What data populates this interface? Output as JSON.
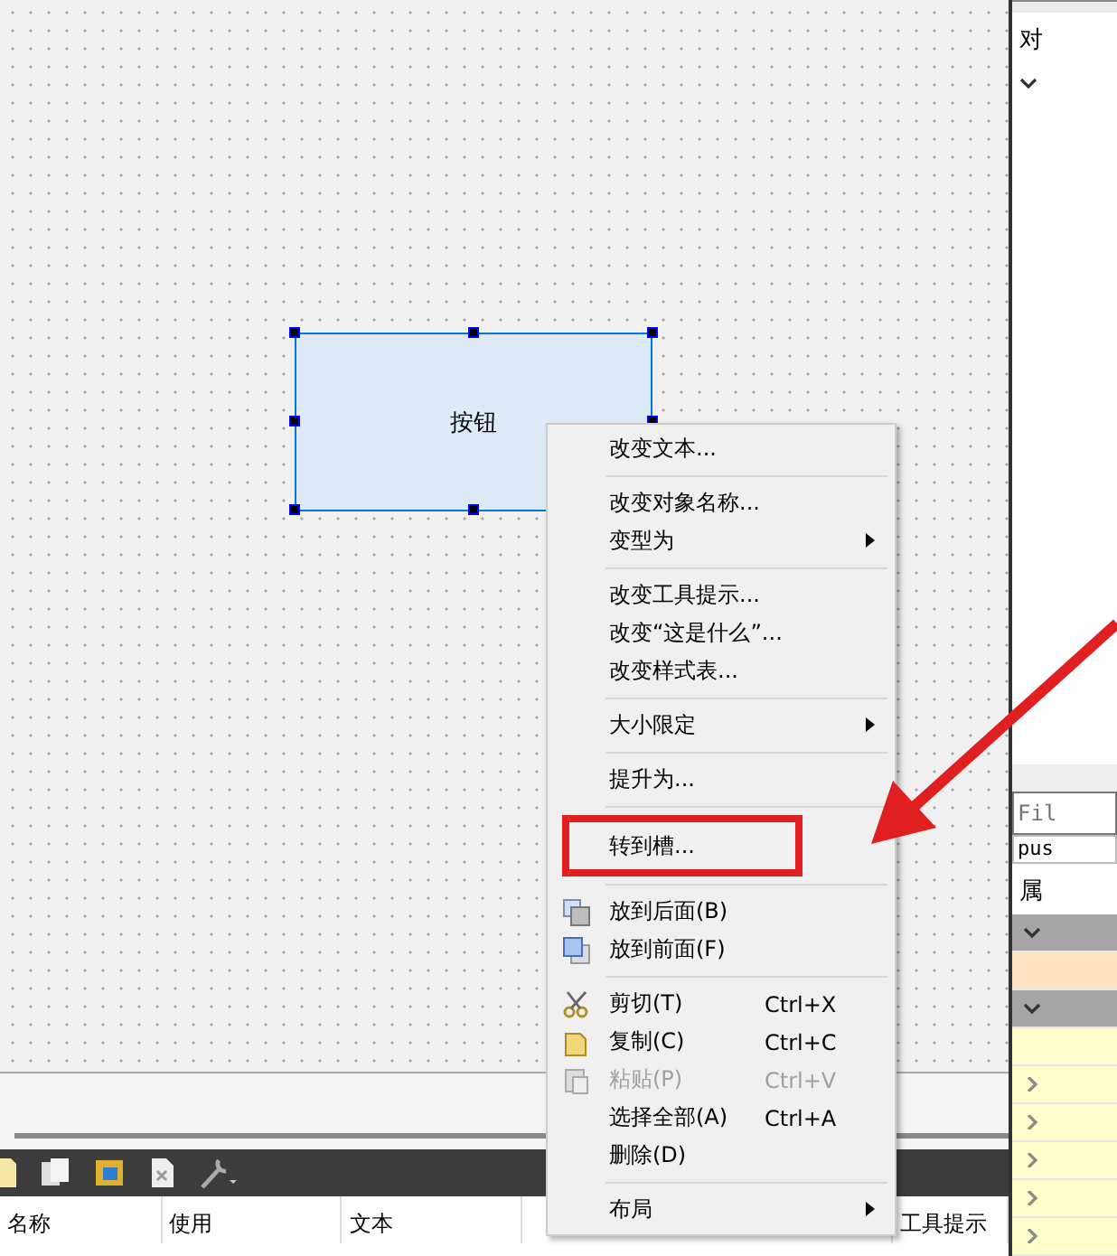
{
  "canvas": {
    "widget": {
      "label": "按钮",
      "selected": true
    }
  },
  "context_menu": {
    "items": [
      {
        "kind": "item",
        "label": "改变文本...",
        "submenu": false,
        "disabled": false
      },
      {
        "kind": "separator"
      },
      {
        "kind": "item",
        "label": "改变对象名称...",
        "submenu": false,
        "disabled": false
      },
      {
        "kind": "item",
        "label": "变型为",
        "submenu": true,
        "disabled": false
      },
      {
        "kind": "separator"
      },
      {
        "kind": "item",
        "label": "改变工具提示...",
        "submenu": false,
        "disabled": false
      },
      {
        "kind": "item",
        "label": "改变“这是什么”...",
        "submenu": false,
        "disabled": false
      },
      {
        "kind": "item",
        "label": "改变样式表...",
        "submenu": false,
        "disabled": false
      },
      {
        "kind": "separator"
      },
      {
        "kind": "item",
        "label": "大小限定",
        "submenu": true,
        "disabled": false
      },
      {
        "kind": "separator"
      },
      {
        "kind": "item",
        "label": "提升为...",
        "submenu": false,
        "disabled": false
      },
      {
        "kind": "separator"
      },
      {
        "kind": "item",
        "label": "转到槽...",
        "submenu": false,
        "disabled": false,
        "annotated": true
      },
      {
        "kind": "separator"
      },
      {
        "kind": "item",
        "label": "放到后面(B)",
        "submenu": false,
        "disabled": false
      },
      {
        "kind": "item",
        "label": "放到前面(F)",
        "submenu": false,
        "disabled": false
      },
      {
        "kind": "separator"
      },
      {
        "kind": "item",
        "label": "剪切(T)",
        "shortcut": "Ctrl+X",
        "submenu": false,
        "disabled": false
      },
      {
        "kind": "item",
        "label": "复制(C)",
        "shortcut": "Ctrl+C",
        "submenu": false,
        "disabled": false
      },
      {
        "kind": "item",
        "label": "粘贴(P)",
        "shortcut": "Ctrl+V",
        "submenu": false,
        "disabled": true
      },
      {
        "kind": "item",
        "label": "选择全部(A)",
        "shortcut": "Ctrl+A",
        "submenu": false,
        "disabled": false
      },
      {
        "kind": "item",
        "label": "删除(D)",
        "submenu": false,
        "disabled": false
      },
      {
        "kind": "separator"
      },
      {
        "kind": "item",
        "label": "布局",
        "submenu": true,
        "disabled": false
      }
    ]
  },
  "action_table": {
    "columns": [
      "名称",
      "使用",
      "文本",
      "工具提示"
    ]
  },
  "object_panel": {
    "title": "对"
  },
  "property_panel": {
    "filter_placeholder": "Fil",
    "object_name": "pus",
    "title": "属",
    "rows": [
      {
        "kind": "group",
        "expanded": true
      },
      {
        "kind": "highlight"
      },
      {
        "kind": "group",
        "expanded": true
      },
      {
        "kind": "plain"
      },
      {
        "kind": "property",
        "expanded": false
      },
      {
        "kind": "property",
        "expanded": false
      },
      {
        "kind": "property",
        "expanded": false
      },
      {
        "kind": "property",
        "expanded": false
      },
      {
        "kind": "property",
        "expanded": false
      }
    ]
  }
}
